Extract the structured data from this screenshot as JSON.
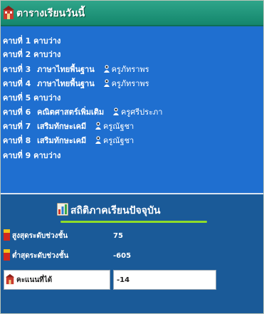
{
  "header": {
    "title": "ตารางเรียนวันนี้",
    "icon": "school-icon"
  },
  "periods": [
    {
      "label": "คาบที่ 1",
      "subject": "คาบว่าง",
      "teacher": ""
    },
    {
      "label": "คาบที่ 2",
      "subject": "คาบว่าง",
      "teacher": ""
    },
    {
      "label": "คาบที่ 3",
      "subject": "ภาษาไทยพื้นฐาน",
      "teacher": "ครูภัทราพร"
    },
    {
      "label": "คาบที่ 4",
      "subject": "ภาษาไทยพื้นฐาน",
      "teacher": "ครูภัทราพร"
    },
    {
      "label": "คาบที่ 5",
      "subject": "คาบว่าง",
      "teacher": ""
    },
    {
      "label": "คาบที่ 6",
      "subject": "คณิตศาสตร์เพิ่มเติม",
      "teacher": "ครูศรีประภา"
    },
    {
      "label": "คาบที่ 7",
      "subject": "เสริมทักษะเคมี",
      "teacher": "ครูณัฐชา"
    },
    {
      "label": "คาบที่ 8",
      "subject": "เสริมทักษะเคมี",
      "teacher": "ครูณัฐชา"
    },
    {
      "label": "คาบที่ 9",
      "subject": "คาบว่าง",
      "teacher": ""
    }
  ],
  "stats": {
    "title": "สถิติภาคเรียนปัจจุบัน",
    "rows": [
      {
        "label": "สูงสุดระดับช่วงชั้น",
        "value": "75"
      },
      {
        "label": "ต่ำสุดระดับช่วงชั้น",
        "value": "-605"
      },
      {
        "label": "คะแนนที่ได้",
        "value": "-14"
      }
    ]
  },
  "colors": {
    "header_bg": "#14866c",
    "panel_bg": "#1f6fd0",
    "stats_bg": "#1a5a98",
    "accent_underline": "#8fdc2a"
  }
}
